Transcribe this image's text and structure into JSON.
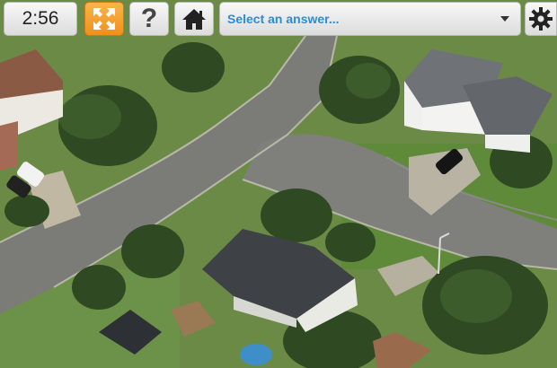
{
  "toolbar": {
    "timer": "2:56",
    "help_label": "?",
    "answer_select": {
      "placeholder": "Select an answer..."
    }
  },
  "colors": {
    "accent_orange": "#f39a21",
    "select_text": "#2f8ccf",
    "toolbar_bg": "#e6e6e6"
  },
  "icons": [
    "fullscreen-icon",
    "help-icon",
    "home-icon",
    "chevron-down-icon",
    "gear-icon"
  ]
}
